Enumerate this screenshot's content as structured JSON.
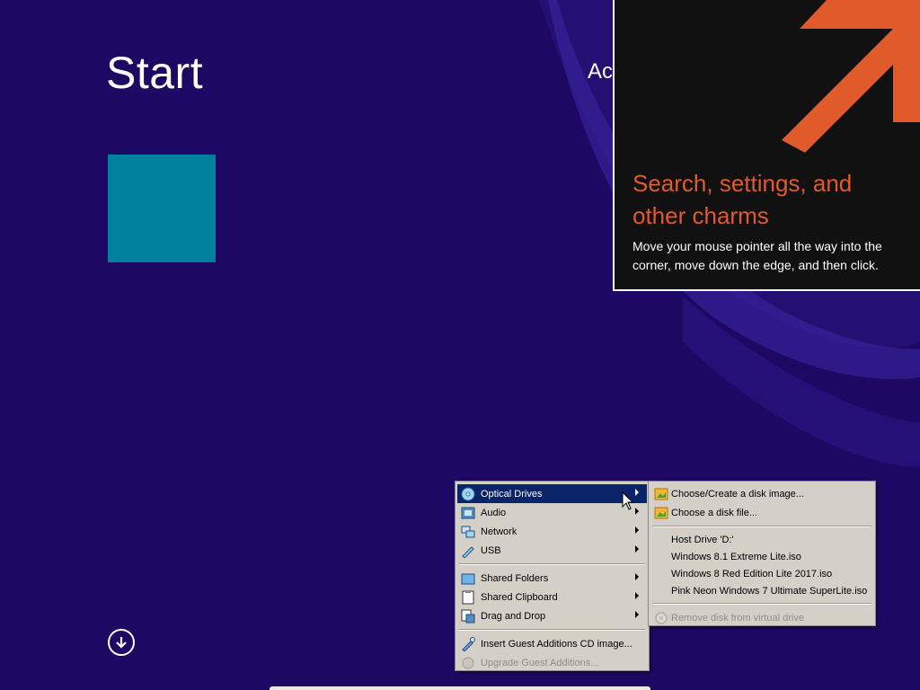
{
  "start": {
    "title": "Start",
    "user_partial": "Ac"
  },
  "charm_hint": {
    "heading": "Search, settings, and other charms",
    "body": "Move your mouse pointer all the way into the corner, move down the edge, and then click.",
    "accent_color": "#e05a2c"
  },
  "tile": {
    "color": "#00809c"
  },
  "context_menu": {
    "items": [
      {
        "label": "Optical Drives",
        "icon": "optical-disc-icon",
        "submenu": true,
        "highlighted": true
      },
      {
        "label": "Audio",
        "icon": "audio-icon",
        "submenu": true
      },
      {
        "label": "Network",
        "icon": "network-icon",
        "submenu": true
      },
      {
        "label": "USB",
        "icon": "usb-icon",
        "submenu": true
      },
      {
        "label": "Shared Folders",
        "icon": "shared-folder-icon",
        "submenu": true
      },
      {
        "label": "Shared Clipboard",
        "icon": "clipboard-icon",
        "submenu": true
      },
      {
        "label": "Drag and Drop",
        "icon": "drag-drop-icon",
        "submenu": true
      },
      {
        "label": "Insert Guest Additions CD image...",
        "icon": "guest-additions-icon"
      },
      {
        "label": "Upgrade Guest Additions...",
        "icon": "upgrade-icon",
        "disabled": true
      }
    ]
  },
  "optical_submenu": {
    "items": [
      {
        "label": "Choose/Create a disk image...",
        "icon": "disk-image-icon"
      },
      {
        "label": "Choose a disk file...",
        "icon": "disk-file-icon"
      },
      {
        "label": "Host Drive 'D:'"
      },
      {
        "label": "Windows 8.1 Extreme Lite.iso"
      },
      {
        "label": "Windows 8 Red Edition Lite 2017.iso"
      },
      {
        "label": "Pink Neon Windows 7 Ultimate  SuperLite.iso"
      },
      {
        "label": "Remove disk from virtual drive",
        "icon": "remove-disk-icon",
        "disabled": true
      }
    ]
  }
}
